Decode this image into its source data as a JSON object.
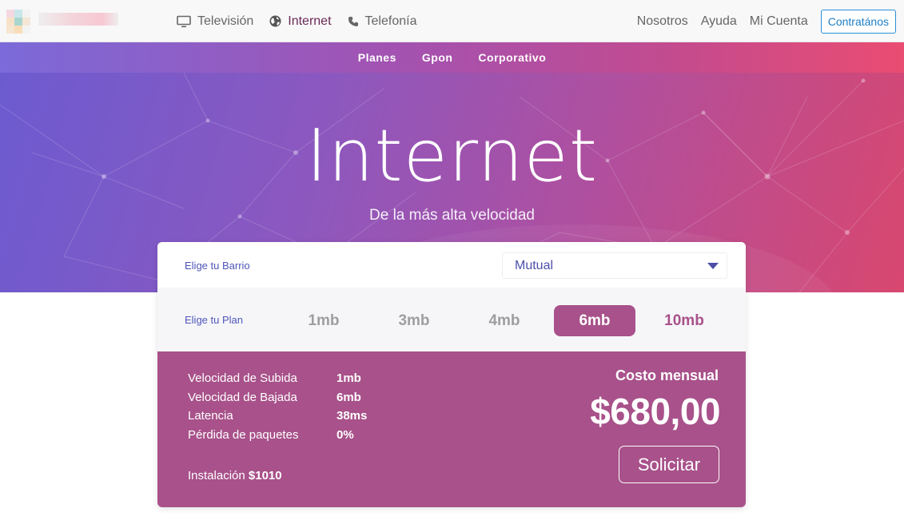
{
  "topnav": {
    "left_items": [
      {
        "label": "Televisión",
        "icon": "tv-icon"
      },
      {
        "label": "Internet",
        "icon": "globe-icon"
      },
      {
        "label": "Telefonía",
        "icon": "phone-icon"
      }
    ],
    "right_items": [
      "Nosotros",
      "Ayuda",
      "Mi Cuenta"
    ],
    "cta": "Contratános"
  },
  "subnav": [
    "Planes",
    "Gpon",
    "Corporativo"
  ],
  "hero": {
    "title": "Internet",
    "subtitle": "De la más alta velocidad"
  },
  "selector": {
    "barrio_label": "Elige tu Barrio",
    "barrio_value": "Mutual",
    "plan_label": "Elige tu Plan",
    "plans": [
      "1mb",
      "3mb",
      "4mb",
      "6mb",
      "10mb"
    ],
    "selected_plan": "6mb"
  },
  "details": {
    "specs": [
      {
        "label": "Velocidad de Subida",
        "value": "1mb"
      },
      {
        "label": "Velocidad de Bajada",
        "value": "6mb"
      },
      {
        "label": "Latencia",
        "value": "38ms"
      },
      {
        "label": "Pérdida de paquetes",
        "value": "0%"
      }
    ],
    "install_label": "Instalación",
    "install_value": "$1010",
    "cost_label": "Costo mensual",
    "price": "$680,00",
    "cta": "Solicitar"
  },
  "colors": {
    "accent": "#a8518a",
    "link_blue": "#1e7fc5",
    "label_blue": "#4f56b8"
  }
}
